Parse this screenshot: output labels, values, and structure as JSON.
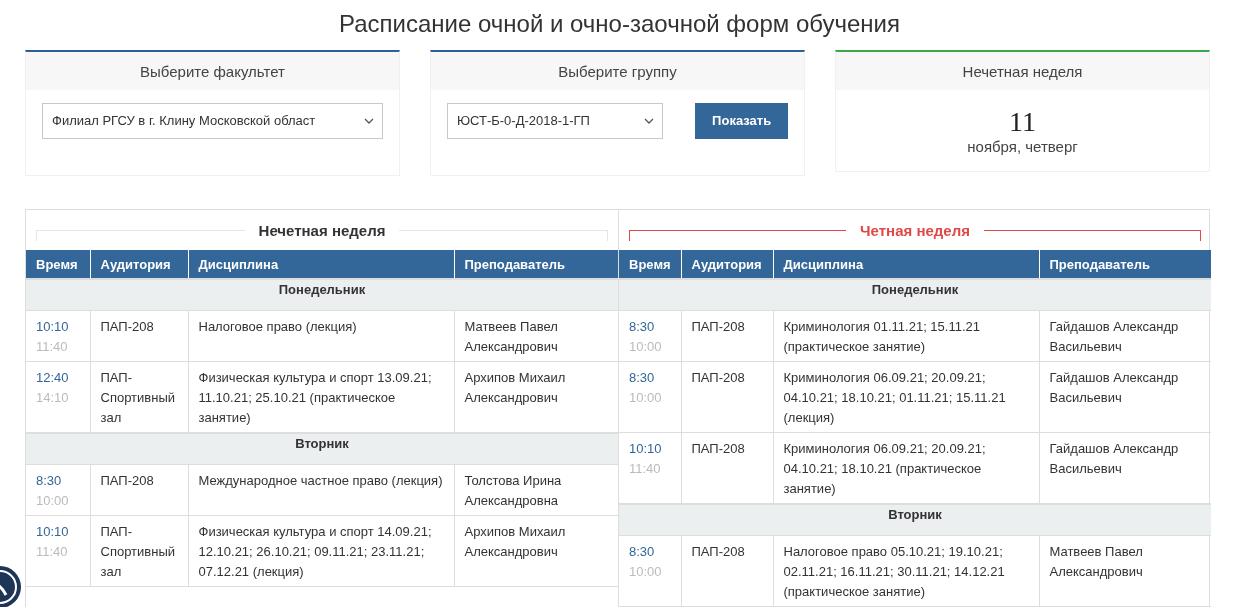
{
  "title": "Расписание очной и очно-заочной форм обучения",
  "faculty_card": {
    "header": "Выберите факультет",
    "select_value": "Филиал РГСУ в г. Клину Московской област"
  },
  "group_card": {
    "header": "Выберите группу",
    "select_value": "ЮСТ-Б-0-Д-2018-1-ГП",
    "button": "Показать"
  },
  "date_card": {
    "header": "Нечетная неделя",
    "day": "11",
    "subtitle": "ноября, четверг"
  },
  "weeks": [
    {
      "title": "Нечетная неделя",
      "highlighted": false,
      "columns": [
        "Время",
        "Аудитория",
        "Дисциплина",
        "Преподаватель"
      ],
      "days": [
        {
          "name": "Понедельник",
          "rows": [
            {
              "start": "10:10",
              "end": "11:40",
              "room": "ПАП-208",
              "subject": "Налоговое право (лекция)",
              "teacher": "Матвеев Павел Александрович"
            },
            {
              "start": "12:40",
              "end": "14:10",
              "room": "ПАП-Спортивный зал",
              "subject": "Физическая культура и спорт 13.09.21; 11.10.21; 25.10.21 (практическое занятие)",
              "teacher": "Архипов Михаил Александрович"
            }
          ]
        },
        {
          "name": "Вторник",
          "rows": [
            {
              "start": "8:30",
              "end": "10:00",
              "room": "ПАП-208",
              "subject": "Международное частное право (лекция)",
              "teacher": "Толстова Ирина Александровна"
            },
            {
              "start": "10:10",
              "end": "11:40",
              "room": "ПАП-Спортивный зал",
              "subject": "Физическая культура и спорт 14.09.21; 12.10.21; 26.10.21; 09.11.21; 23.11.21; 07.12.21 (лекция)",
              "teacher": "Архипов Михаил Александрович"
            }
          ]
        }
      ]
    },
    {
      "title": "Четная неделя",
      "highlighted": true,
      "columns": [
        "Время",
        "Аудитория",
        "Дисциплина",
        "Преподаватель"
      ],
      "days": [
        {
          "name": "Понедельник",
          "rows": [
            {
              "start": "8:30",
              "end": "10:00",
              "room": "ПАП-208",
              "subject": "Криминология 01.11.21; 15.11.21 (практическое занятие)",
              "teacher": "Гайдашов Александр Васильевич"
            },
            {
              "start": "8:30",
              "end": "10:00",
              "room": "ПАП-208",
              "subject": "Криминология 06.09.21; 20.09.21; 04.10.21; 18.10.21; 01.11.21; 15.11.21 (лекция)",
              "teacher": "Гайдашов Александр Васильевич"
            },
            {
              "start": "10:10",
              "end": "11:40",
              "room": "ПАП-208",
              "subject": "Криминология 06.09.21; 20.09.21; 04.10.21; 18.10.21 (практическое занятие)",
              "teacher": "Гайдашов Александр Васильевич"
            }
          ]
        },
        {
          "name": "Вторник",
          "rows": [
            {
              "start": "8:30",
              "end": "10:00",
              "room": "ПАП-208",
              "subject": "Налоговое право 05.10.21; 19.10.21; 02.11.21; 16.11.21; 30.11.21; 14.12.21 (практическое занятие)",
              "teacher": "Матвеев Павел Александрович"
            }
          ]
        }
      ]
    }
  ]
}
